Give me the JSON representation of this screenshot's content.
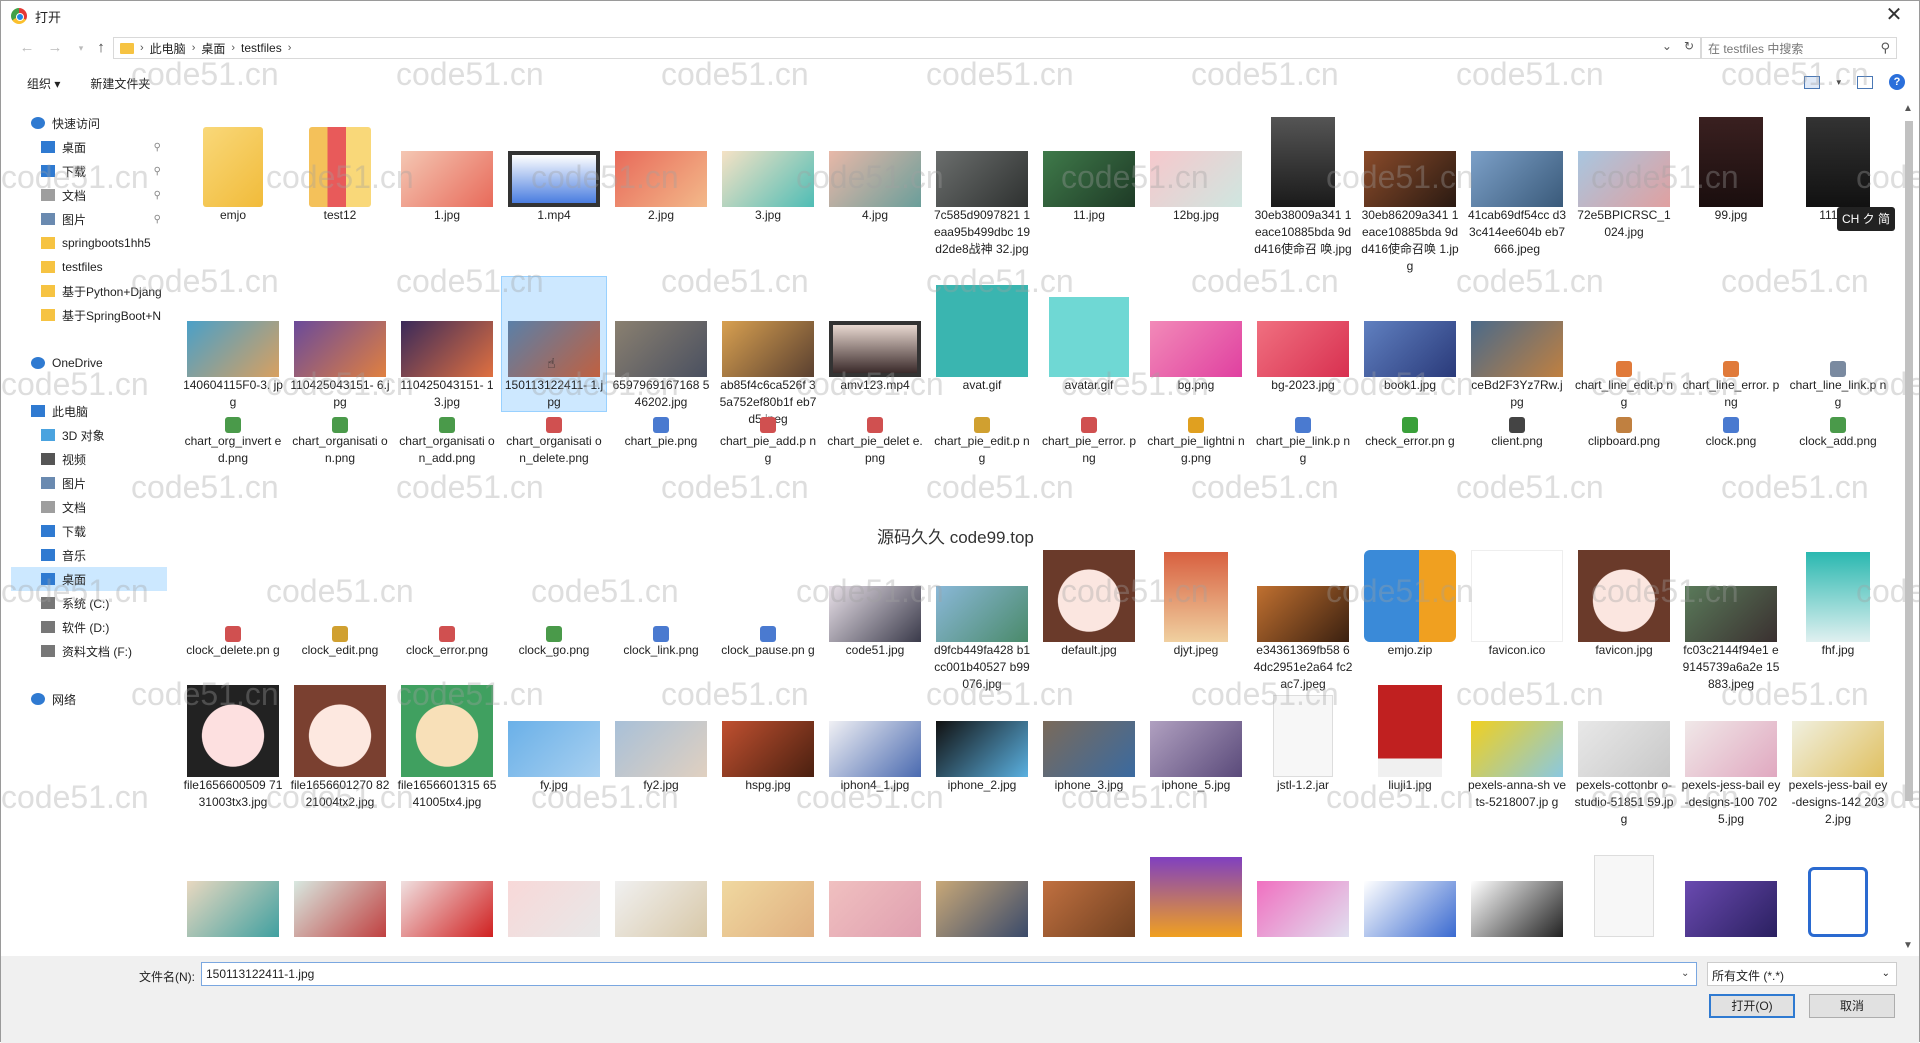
{
  "title": "打开",
  "address": {
    "crumbs": [
      "此电脑",
      "桌面",
      "testfiles"
    ],
    "search_placeholder": "在 testfiles 中搜索"
  },
  "toolbar": {
    "organize": "组织 ▾",
    "new_folder": "新建文件夹"
  },
  "sidebar": [
    {
      "label": "快速访问",
      "icon": "star-icon",
      "color": "#2f7ad1",
      "indent": 0
    },
    {
      "label": "桌面",
      "icon": "desktop-icon",
      "color": "#2f7ad1",
      "indent": 1,
      "pin": true
    },
    {
      "label": "下载",
      "icon": "download-icon",
      "color": "#2f7ad1",
      "indent": 1,
      "pin": true
    },
    {
      "label": "文档",
      "icon": "document-icon",
      "color": "#9e9e9e",
      "indent": 1,
      "pin": true
    },
    {
      "label": "图片",
      "icon": "picture-icon",
      "color": "#6a8ab0",
      "indent": 1,
      "pin": true
    },
    {
      "label": "springboots1hh5",
      "icon": "folder-icon",
      "color": "#f6c342",
      "indent": 1
    },
    {
      "label": "testfiles",
      "icon": "folder-icon",
      "color": "#f6c342",
      "indent": 1
    },
    {
      "label": "基于Python+Djang",
      "icon": "folder-icon",
      "color": "#f6c342",
      "indent": 1
    },
    {
      "label": "基于SpringBoot+N",
      "icon": "folder-icon",
      "color": "#f6c342",
      "indent": 1
    },
    {
      "label": "",
      "icon": "",
      "color": "",
      "indent": 0
    },
    {
      "label": "OneDrive",
      "icon": "cloud-icon",
      "color": "#2f7ad1",
      "indent": 0
    },
    {
      "label": "",
      "icon": "",
      "color": "",
      "indent": 0
    },
    {
      "label": "此电脑",
      "icon": "computer-icon",
      "color": "#2f7ad1",
      "indent": 0
    },
    {
      "label": "3D 对象",
      "icon": "cube-icon",
      "color": "#4aa3df",
      "indent": 1
    },
    {
      "label": "视频",
      "icon": "video-icon",
      "color": "#555",
      "indent": 1
    },
    {
      "label": "图片",
      "icon": "picture-icon",
      "color": "#6a8ab0",
      "indent": 1
    },
    {
      "label": "文档",
      "icon": "document-icon",
      "color": "#9e9e9e",
      "indent": 1
    },
    {
      "label": "下载",
      "icon": "download-icon",
      "color": "#2f7ad1",
      "indent": 1
    },
    {
      "label": "音乐",
      "icon": "music-icon",
      "color": "#2f7ad1",
      "indent": 1
    },
    {
      "label": "桌面",
      "icon": "desktop-icon",
      "color": "#2f7ad1",
      "indent": 1,
      "selected": true
    },
    {
      "label": "系统 (C:)",
      "icon": "drive-icon",
      "color": "#777",
      "indent": 1
    },
    {
      "label": "软件 (D:)",
      "icon": "drive-icon",
      "color": "#777",
      "indent": 1
    },
    {
      "label": "资料文档 (F:)",
      "icon": "drive-icon",
      "color": "#777",
      "indent": 1
    },
    {
      "label": "",
      "icon": "",
      "color": "",
      "indent": 0
    },
    {
      "label": "网络",
      "icon": "network-icon",
      "color": "#2f7ad1",
      "indent": 0
    }
  ],
  "files": [
    [
      {
        "name": "emjo",
        "kind": "folder"
      },
      {
        "name": "test12",
        "kind": "folder2"
      },
      {
        "name": "1.jpg",
        "kind": "img",
        "c1": "#f4c7b3",
        "c2": "#e86a5a"
      },
      {
        "name": "1.mp4",
        "kind": "video",
        "c1": "#fff",
        "c2": "#4a7de0"
      },
      {
        "name": "2.jpg",
        "kind": "img",
        "c1": "#e86a5a",
        "c2": "#f3b98a"
      },
      {
        "name": "3.jpg",
        "kind": "img",
        "c1": "#f5e2c5",
        "c2": "#4fbdb5"
      },
      {
        "name": "4.jpg",
        "kind": "img",
        "c1": "#e8b8a8",
        "c2": "#6a9e9a"
      },
      {
        "name": "7c585d9097821 1eaa95b499dbc 19d2de8战神 32.jpg",
        "kind": "img",
        "c1": "#6b6e6d",
        "c2": "#2e3130"
      },
      {
        "name": "11.jpg",
        "kind": "img",
        "c1": "#3f7a4a",
        "c2": "#1e3a26"
      },
      {
        "name": "12bg.jpg",
        "kind": "img",
        "c1": "#f6c8cc",
        "c2": "#cfe6e0"
      },
      {
        "name": "30eb38009a341 1eace10885bda 9dd416使命召 唤.jpg",
        "kind": "tall",
        "c1": "#555",
        "c2": "#1a1a1a"
      },
      {
        "name": "30eb86209a341 1eace10885bda 9dd416使命召唤 1.jpg",
        "kind": "img",
        "c1": "#8a4b2a",
        "c2": "#2a1a12"
      },
      {
        "name": "41cab69df54cc d33c414ee604b eb7666.jpeg",
        "kind": "img",
        "c1": "#7ca0c8",
        "c2": "#3a5a7a"
      },
      {
        "name": "72e5BPICRSC_1 024.jpg",
        "kind": "img",
        "c1": "#a8c6e0",
        "c2": "#e0a0a0"
      },
      {
        "name": "99.jpg",
        "kind": "tall",
        "c1": "#3a2020",
        "c2": "#1a0e0e"
      },
      {
        "name": "111.jpg",
        "kind": "tall",
        "c1": "#333",
        "c2": "#111"
      }
    ],
    [
      {
        "name": "140604115F0-3. jpg",
        "kind": "img",
        "c1": "#4aa0c8",
        "c2": "#d8a060"
      },
      {
        "name": "110425043151- 6.jpg",
        "kind": "img",
        "c1": "#6a4a9a",
        "c2": "#e08040"
      },
      {
        "name": "110425043151- 13.jpg",
        "kind": "img",
        "c1": "#3a2a5a",
        "c2": "#e07040"
      },
      {
        "name": "150113122411- 1.jpg",
        "kind": "img",
        "c1": "#5a80a8",
        "c2": "#c06040",
        "selected": true
      },
      {
        "name": "6597969167168 546202.jpg",
        "kind": "img",
        "c1": "#8a8070",
        "c2": "#4a5060"
      },
      {
        "name": "ab85f4c6ca526f 35a752ef80b1f eb7d5.jpeg",
        "kind": "img",
        "c1": "#d8a050",
        "c2": "#5a4030"
      },
      {
        "name": "amv123.mp4",
        "kind": "video",
        "c1": "#e8d8d0",
        "c2": "#3a2a2a"
      },
      {
        "name": "avat.gif",
        "kind": "face",
        "c1": "#3ab5b0",
        "c2": "#222"
      },
      {
        "name": "avatar.gif",
        "kind": "bunny",
        "c1": "#6fd8d4",
        "c2": "#fff"
      },
      {
        "name": "bg.png",
        "kind": "img",
        "c1": "#f28ab8",
        "c2": "#e040a0"
      },
      {
        "name": "bg-2023.jpg",
        "kind": "img",
        "c1": "#f07080",
        "c2": "#d83050"
      },
      {
        "name": "book1.jpg",
        "kind": "img",
        "c1": "#6080c0",
        "c2": "#2a3a7a"
      },
      {
        "name": "ceBd2F3Yz7Rw.j pg",
        "kind": "img",
        "c1": "#4a6a8a",
        "c2": "#c08040"
      },
      {
        "name": "chart_line_edit.p ng",
        "kind": "icon",
        "c1": "#e07a3a"
      },
      {
        "name": "chart_line_error. png",
        "kind": "icon",
        "c1": "#e07a3a"
      },
      {
        "name": "chart_line_link.p ng",
        "kind": "icon",
        "c1": "#7a8aa0"
      }
    ],
    [
      {
        "name": "chart_org_invert ed.png",
        "kind": "icon",
        "c1": "#4a9a4a"
      },
      {
        "name": "chart_organisati on.png",
        "kind": "icon",
        "c1": "#4a9a4a"
      },
      {
        "name": "chart_organisati on_add.png",
        "kind": "icon",
        "c1": "#4a9a4a"
      },
      {
        "name": "chart_organisati on_delete.png",
        "kind": "icon",
        "c1": "#d05050"
      },
      {
        "name": "chart_pie.png",
        "kind": "icon",
        "c1": "#4a7ad0"
      },
      {
        "name": "chart_pie_add.p ng",
        "kind": "icon",
        "c1": "#d05050"
      },
      {
        "name": "chart_pie_delet e.png",
        "kind": "icon",
        "c1": "#d05050"
      },
      {
        "name": "chart_pie_edit.p ng",
        "kind": "icon",
        "c1": "#d0a030"
      },
      {
        "name": "chart_pie_error. png",
        "kind": "icon",
        "c1": "#d05050"
      },
      {
        "name": "chart_pie_lightni ng.png",
        "kind": "icon",
        "c1": "#e0a020"
      },
      {
        "name": "chart_pie_link.p ng",
        "kind": "icon",
        "c1": "#4a7ad0"
      },
      {
        "name": "check_error.pn g",
        "kind": "icon",
        "c1": "#3aa03a"
      },
      {
        "name": "client.png",
        "kind": "icon",
        "c1": "#444"
      },
      {
        "name": "clipboard.png",
        "kind": "icon",
        "c1": "#c08040"
      },
      {
        "name": "clock.png",
        "kind": "icon",
        "c1": "#4a7ad0"
      },
      {
        "name": "clock_add.png",
        "kind": "icon",
        "c1": "#4a9a4a"
      }
    ],
    [
      {
        "name": "clock_delete.pn g",
        "kind": "icon",
        "c1": "#d05050"
      },
      {
        "name": "clock_edit.png",
        "kind": "icon",
        "c1": "#d0a030"
      },
      {
        "name": "clock_error.png",
        "kind": "icon",
        "c1": "#d05050"
      },
      {
        "name": "clock_go.png",
        "kind": "icon",
        "c1": "#4a9a4a"
      },
      {
        "name": "clock_link.png",
        "kind": "icon",
        "c1": "#4a7ad0"
      },
      {
        "name": "clock_pause.pn g",
        "kind": "icon",
        "c1": "#4a7ad0"
      },
      {
        "name": "code51.jpg",
        "kind": "img",
        "c1": "#e8e0e8",
        "c2": "#3a3a4a"
      },
      {
        "name": "d9fcb449fa428 b1cc001b40527 b99076.jpg",
        "kind": "img",
        "c1": "#8ab8d8",
        "c2": "#4a8a6a"
      },
      {
        "name": "default.jpg",
        "kind": "girl",
        "c1": "#fbe6e0",
        "c2": "#6a3a2a"
      },
      {
        "name": "djyt.jpeg",
        "kind": "tall",
        "c1": "#d86040",
        "c2": "#f0d0a0"
      },
      {
        "name": "e34361369fb58 64dc2951e2a64 fc2ac7.jpeg",
        "kind": "img",
        "c1": "#c07030",
        "c2": "#3a2010"
      },
      {
        "name": "emjo.zip",
        "kind": "zip",
        "c1": "#3a8ad8",
        "c2": "#f0a020"
      },
      {
        "name": "favicon.ico",
        "kind": "vico",
        "c1": "#2aa87a",
        "c2": "#fff"
      },
      {
        "name": "favicon.jpg",
        "kind": "girl",
        "c1": "#fbe6e0",
        "c2": "#6a3a2a"
      },
      {
        "name": "fc03c2144f94e1 e9145739a6a2e 15883.jpeg",
        "kind": "img",
        "c1": "#5a7a5a",
        "c2": "#3a3030"
      },
      {
        "name": "fhf.jpg",
        "kind": "tall",
        "c1": "#2ab8b0",
        "c2": "#e0f0f0"
      }
    ],
    [
      {
        "name": "file1656600509 7131003tx3.jpg",
        "kind": "pig",
        "c1": "#fde0e0",
        "c2": "#222"
      },
      {
        "name": "file1656601270 8221004tx2.jpg",
        "kind": "girl2",
        "c1": "#fde8e0",
        "c2": "#7a4030"
      },
      {
        "name": "file1656601315 6541005tx4.jpg",
        "kind": "girl3",
        "c1": "#f8e0b8",
        "c2": "#40a060"
      },
      {
        "name": "fy.jpg",
        "kind": "img",
        "c1": "#6ab0e8",
        "c2": "#a8d0f0"
      },
      {
        "name": "fy2.jpg",
        "kind": "img",
        "c1": "#a8c0d8",
        "c2": "#e0d0c0"
      },
      {
        "name": "hspg.jpg",
        "kind": "img",
        "c1": "#c05030",
        "c2": "#4a2010"
      },
      {
        "name": "iphon4_1.jpg",
        "kind": "img",
        "c1": "#f0f0f4",
        "c2": "#4a6ab0"
      },
      {
        "name": "iphone_2.jpg",
        "kind": "img",
        "c1": "#111",
        "c2": "#5ab0e0"
      },
      {
        "name": "iphone_3.jpg",
        "kind": "img",
        "c1": "#7a6a5a",
        "c2": "#3a6aa0"
      },
      {
        "name": "iphone_5.jpg",
        "kind": "img",
        "c1": "#b0a0c0",
        "c2": "#5a4a7a"
      },
      {
        "name": "jstl-1.2.jar",
        "kind": "blank"
      },
      {
        "name": "liuji1.jpg",
        "kind": "book",
        "c1": "#c02020",
        "c2": "#f0f0f0"
      },
      {
        "name": "pexels-anna-sh vets-5218007.jp g",
        "kind": "img",
        "c1": "#f0d020",
        "c2": "#8ac8e0"
      },
      {
        "name": "pexels-cottonbr o-studio-51851 59.jpg",
        "kind": "img",
        "c1": "#e8e8e8",
        "c2": "#c8c8c8"
      },
      {
        "name": "pexels-jess-bail ey-designs-100 7025.jpg",
        "kind": "img",
        "c1": "#f0e8e8",
        "c2": "#e0a8c0"
      },
      {
        "name": "pexels-jess-bail ey-designs-142 2032.jpg",
        "kind": "img",
        "c1": "#f0f0e0",
        "c2": "#e0c060"
      }
    ],
    [
      {
        "name": "",
        "kind": "partial",
        "c1": "#e8d8c0",
        "c2": "#40a0a0"
      },
      {
        "name": "",
        "kind": "partial",
        "c1": "#d8e8e0",
        "c2": "#c04040"
      },
      {
        "name": "",
        "kind": "partial",
        "c1": "#f0e0e0",
        "c2": "#d02020"
      },
      {
        "name": "",
        "kind": "partial",
        "c1": "#f8d8d8",
        "c2": "#e8e8e8"
      },
      {
        "name": "",
        "kind": "partial",
        "c1": "#f0f0f0",
        "c2": "#d8c8a8"
      },
      {
        "name": "",
        "kind": "partial",
        "c1": "#f0d8a0",
        "c2": "#e0b080"
      },
      {
        "name": "",
        "kind": "partial",
        "c1": "#f0c0c0",
        "c2": "#e0a0b0"
      },
      {
        "name": "",
        "kind": "partial",
        "c1": "#c8a878",
        "c2": "#3a4a6a"
      },
      {
        "name": "",
        "kind": "partial",
        "c1": "#c07040",
        "c2": "#704020"
      },
      {
        "name": "",
        "kind": "partialtall",
        "c1": "#8040c0",
        "c2": "#f0a020"
      },
      {
        "name": "",
        "kind": "partial",
        "c1": "#f070c0",
        "c2": "#e0e0f0"
      },
      {
        "name": "",
        "kind": "partial",
        "c1": "#fff",
        "c2": "#3a6ad0"
      },
      {
        "name": "",
        "kind": "partial",
        "c1": "#fff",
        "c2": "#222"
      },
      {
        "name": "",
        "kind": "blankpartial"
      },
      {
        "name": "",
        "kind": "partial",
        "c1": "#6a4ab0",
        "c2": "#2a2060"
      },
      {
        "name": "",
        "kind": "word",
        "c1": "#2a6ad0"
      }
    ]
  ],
  "watermark": "code51.cn",
  "overlay_text": "源码久久 code99.top",
  "ime_badge": "CH ク 简",
  "footer": {
    "filename_label": "文件名(N):",
    "filename_value": "150113122411-1.jpg",
    "filetype": "所有文件 (*.*)",
    "open": "打开(O)",
    "cancel": "取消"
  }
}
